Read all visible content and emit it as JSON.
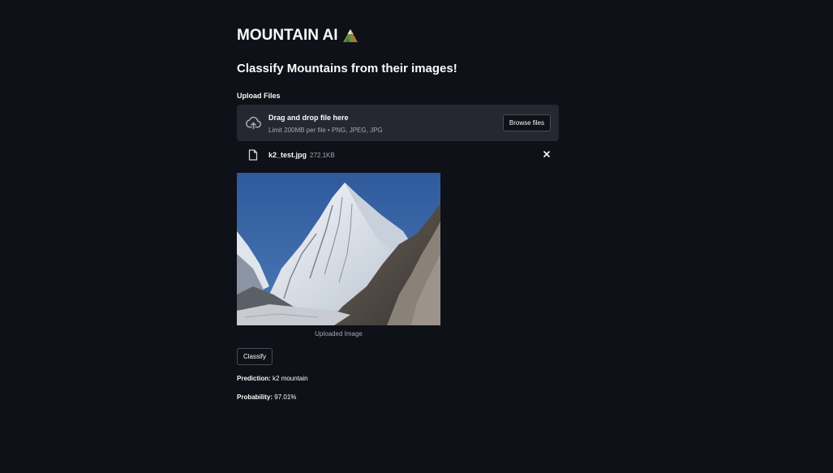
{
  "app": {
    "title": "MOUNTAIN AI",
    "title_icon": "mountain-emoji-icon",
    "subtitle": "Classify Mountains from their images!"
  },
  "uploader": {
    "label": "Upload Files",
    "drop_title": "Drag and drop file here",
    "limit_text": "Limit 200MB per file • PNG, JPEG, JPG",
    "browse_label": "Browse files",
    "icon": "cloud-upload-icon"
  },
  "file": {
    "name": "k2_test.jpg",
    "size": "272.1KB",
    "icon": "file-icon",
    "remove_icon": "close-icon"
  },
  "image": {
    "caption": "Uploaded Image"
  },
  "actions": {
    "classify_label": "Classify"
  },
  "results": {
    "prediction_label": "Prediction:",
    "prediction_value": "k2 mountain",
    "probability_label": "Probability:",
    "probability_value": "97.01%"
  },
  "colors": {
    "background": "#0e1117",
    "panel": "#262730",
    "text": "#fafafa",
    "muted": "#a3a8b4"
  }
}
